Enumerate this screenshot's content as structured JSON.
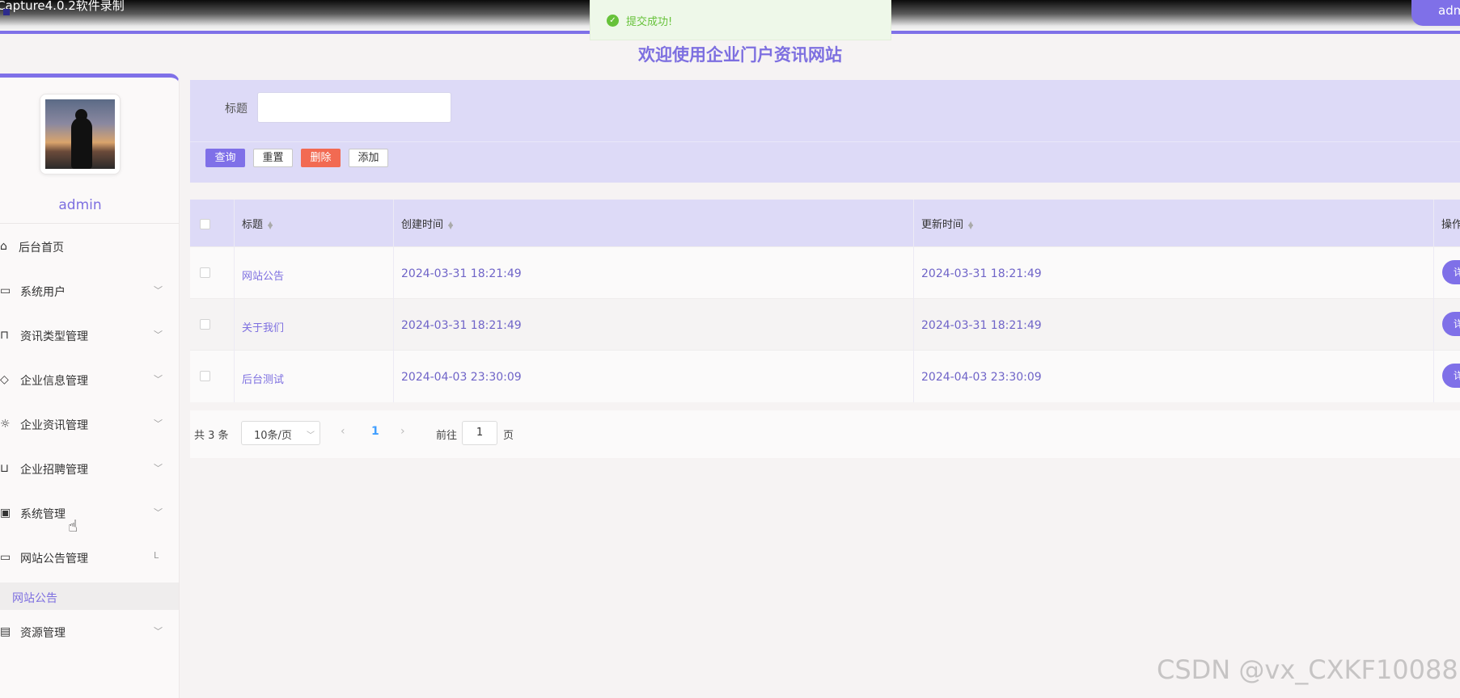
{
  "top": {
    "caption": "Capture4.0.2软件录制",
    "user_label": "admin"
  },
  "toast": {
    "message": "提交成功!"
  },
  "page_title": "欢迎使用企业门户资讯网站",
  "sidebar": {
    "username": "admin",
    "items": [
      {
        "label": "后台首页",
        "icon": "home-icon"
      },
      {
        "label": "系统用户",
        "icon": "laptop-icon"
      },
      {
        "label": "资讯类型管理",
        "icon": "bookmark-icon"
      },
      {
        "label": "企业信息管理",
        "icon": "tag-icon"
      },
      {
        "label": "企业资讯管理",
        "icon": "sun-icon"
      },
      {
        "label": "企业招聘管理",
        "icon": "inbox-icon"
      },
      {
        "label": "系统管理",
        "icon": "clipboard-icon"
      },
      {
        "label": "网站公告管理",
        "icon": "message-icon"
      },
      {
        "label": "资源管理",
        "icon": "card-icon"
      }
    ],
    "active_sub_item": "网站公告"
  },
  "search": {
    "title_label": "标题",
    "title_value": "",
    "buttons": {
      "query": "查询",
      "reset": "重置",
      "delete": "删除",
      "add": "添加"
    }
  },
  "table": {
    "columns": {
      "title": "标题",
      "created": "创建时间",
      "updated": "更新时间",
      "ops": "操作"
    },
    "rows": [
      {
        "title": "网站公告",
        "created": "2024-03-31 18:21:49",
        "updated": "2024-03-31 18:21:49",
        "op": "详"
      },
      {
        "title": "关于我们",
        "created": "2024-03-31 18:21:49",
        "updated": "2024-03-31 18:21:49",
        "op": "详"
      },
      {
        "title": "后台测试",
        "created": "2024-04-03 23:30:09",
        "updated": "2024-04-03 23:30:09",
        "op": "详"
      }
    ]
  },
  "pagination": {
    "total": "共 3 条",
    "page_size": "10条/页",
    "current_page": "1",
    "goto_label": "前往",
    "goto_value": "1",
    "page_suffix": "页"
  },
  "watermark": "CSDN @vx_CXKF10088"
}
